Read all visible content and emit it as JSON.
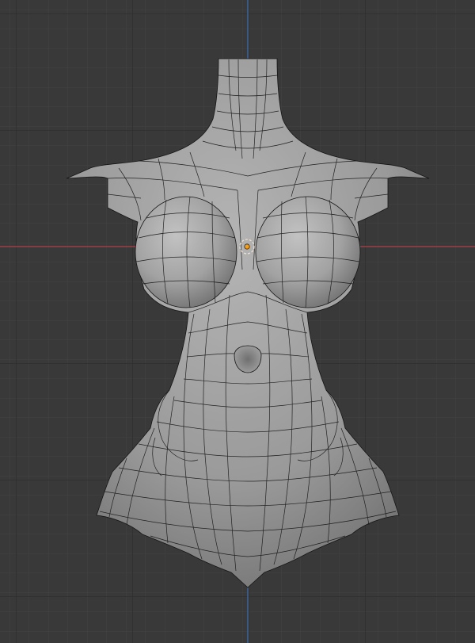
{
  "viewport": {
    "background": "#393939",
    "grid_minor_color": "#434343",
    "grid_major_color": "#2b2b2b",
    "axis_x_color": "#b0414a",
    "axis_y_color": "#3f6fb0",
    "mesh_fill": "#9a9a9a",
    "wire_color": "#151515",
    "origin_color": "#f0a020"
  },
  "scene": {
    "object_type": "sculpt mesh (wireframe overlay)",
    "origin_marker": "object-origin-icon"
  }
}
